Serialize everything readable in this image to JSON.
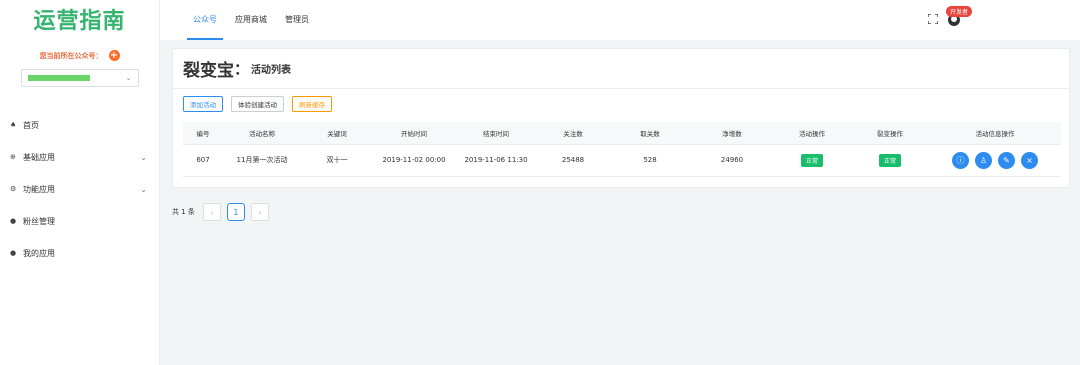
{
  "sidebar": {
    "logo_text": "运营指南",
    "account_label": "您当前所在公众号：",
    "nav": [
      {
        "label": "首页",
        "icon": "home-icon",
        "has_children": false
      },
      {
        "label": "基础应用",
        "icon": "grid-icon",
        "has_children": true
      },
      {
        "label": "功能应用",
        "icon": "settings-icon",
        "has_children": true
      },
      {
        "label": "粉丝管理",
        "icon": "users-icon",
        "has_children": false
      },
      {
        "label": "我的应用",
        "icon": "apps-icon",
        "has_children": false
      }
    ]
  },
  "topbar": {
    "tabs": [
      {
        "label": "公众号",
        "active": true
      },
      {
        "label": "应用商城",
        "active": false
      },
      {
        "label": "管理员",
        "active": false
      }
    ],
    "dev_badge": "开发者"
  },
  "page": {
    "title_main": "裂变宝",
    "title_sep": "：",
    "title_sub": "活动列表",
    "buttons": {
      "add": "添加活动",
      "experience": "体验创建活动",
      "refresh": "刷新缓存"
    }
  },
  "table": {
    "headers": [
      "编号",
      "活动名称",
      "关键词",
      "开始时间",
      "结束时间",
      "关注数",
      "取关数",
      "净增数",
      "活动操作",
      "裂变操作",
      "活动信息操作"
    ],
    "rows": [
      {
        "id": "607",
        "name": "11月第一次活动",
        "keyword": "双十一",
        "start": "2019-11-02 00:00",
        "end": "2019-11-06 11:30",
        "follow": "25488",
        "unfollow": "528",
        "net": "24960",
        "activity_status": "正常",
        "fission_status": "正常"
      }
    ]
  },
  "pager": {
    "total": "共 1 条",
    "current_page": "1",
    "prev": "‹",
    "next": "›"
  },
  "colors": {
    "accent": "#2d8cf0",
    "success": "#19be6b",
    "warning": "#ff9900",
    "logo": "#35b36f"
  }
}
